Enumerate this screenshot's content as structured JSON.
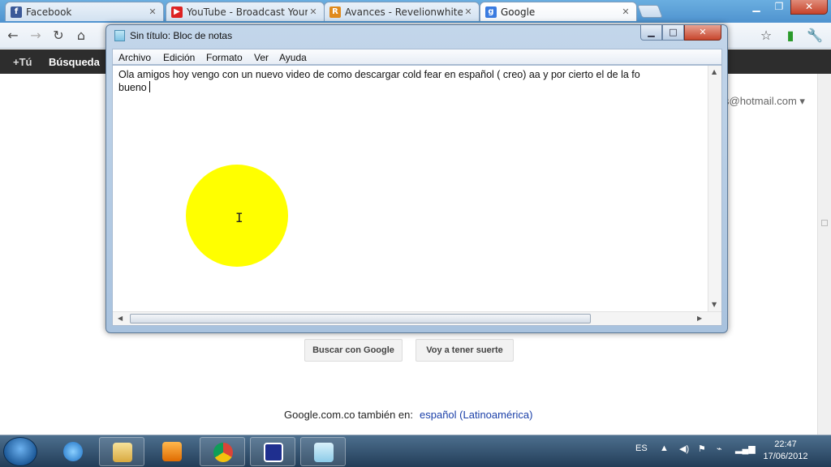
{
  "browser": {
    "tabs": [
      {
        "label": "Facebook",
        "favicon": "facebook-icon",
        "color": "#3b5998",
        "glyph": "f"
      },
      {
        "label": "YouTube - Broadcast Yours",
        "favicon": "youtube-icon",
        "color": "#d22",
        "glyph": "▶"
      },
      {
        "label": "Avances - Revelionwhite.jin",
        "favicon": "blog-icon",
        "color": "#e08a1c",
        "glyph": "R"
      },
      {
        "label": "Google",
        "favicon": "google-icon",
        "color": "#3a7be0",
        "glyph": "g"
      }
    ]
  },
  "google": {
    "bar_items": [
      "+Tú",
      "Búsqueda"
    ],
    "account": "s@hotmail.com ▾",
    "search_button": "Buscar con Google",
    "lucky_button": "Voy a tener suerte",
    "footer_prefix": "Google.com.co también en:",
    "footer_link": "español (Latinoamérica)"
  },
  "notepad": {
    "title": "Sin título: Bloc de notas",
    "menu": [
      "Archivo",
      "Edición",
      "Formato",
      "Ver",
      "Ayuda"
    ],
    "text_line1": "Ola amigos hoy vengo con un nuevo video de como descargar cold fear en español ( creo) aa y por cierto el de la fo",
    "text_line2": "bueno"
  },
  "taskbar": {
    "language": "ES",
    "time": "22:47",
    "date": "17/06/2012"
  }
}
